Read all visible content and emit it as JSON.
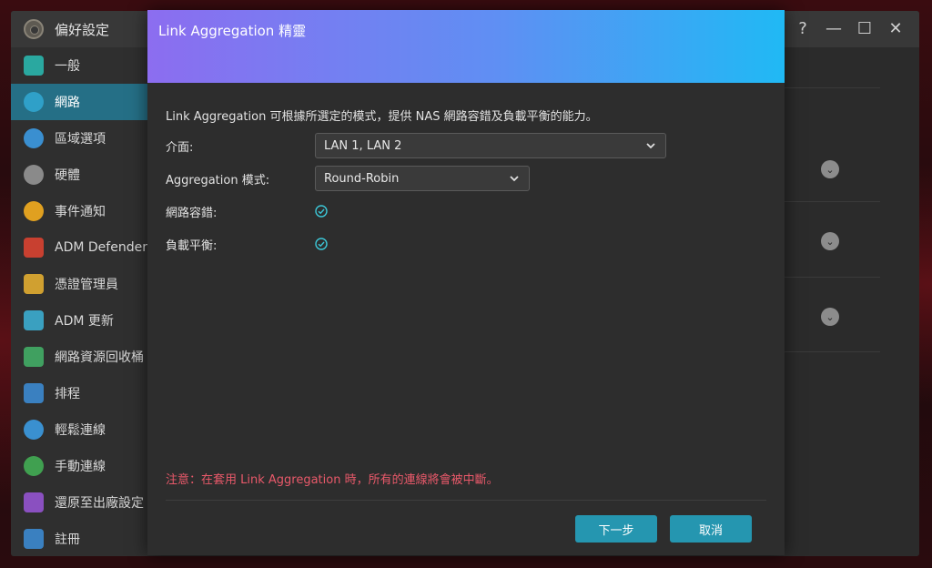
{
  "window": {
    "title": "偏好設定",
    "controls": {
      "help": "?",
      "minimize": "—",
      "maximize": "☐",
      "close": "✕"
    }
  },
  "sidebar": {
    "items": [
      {
        "label": "一般",
        "icon": "general-icon",
        "color": "#2aa8a0"
      },
      {
        "label": "網路",
        "icon": "network-globe-icon",
        "color": "#2fa0c8",
        "active": true
      },
      {
        "label": "區域選項",
        "icon": "region-icon",
        "color": "#3a8fd0"
      },
      {
        "label": "硬體",
        "icon": "hardware-icon",
        "color": "#8a8a8a"
      },
      {
        "label": "事件通知",
        "icon": "notification-icon",
        "color": "#e0a020"
      },
      {
        "label": "ADM Defender",
        "icon": "defender-icon",
        "color": "#c84030"
      },
      {
        "label": "憑證管理員",
        "icon": "certificate-icon",
        "color": "#d0a030"
      },
      {
        "label": "ADM 更新",
        "icon": "update-icon",
        "color": "#3aa0c0"
      },
      {
        "label": "網路資源回收桶",
        "icon": "recycle-bin-icon",
        "color": "#40a060"
      },
      {
        "label": "排程",
        "icon": "schedule-icon",
        "color": "#3a80c0"
      },
      {
        "label": "輕鬆連線",
        "icon": "ezconnect-icon",
        "color": "#3a90d0"
      },
      {
        "label": "手動連線",
        "icon": "manual-connect-icon",
        "color": "#40a050"
      },
      {
        "label": "還原至出廠設定",
        "icon": "reset-icon",
        "color": "#8a50c0"
      },
      {
        "label": "註冊",
        "icon": "registration-icon",
        "color": "#3a80c0"
      }
    ]
  },
  "dialog": {
    "title": "Link Aggregation 精靈",
    "description": "Link Aggregation 可根據所選定的模式，提供 NAS 網路容錯及負載平衡的能力。",
    "interface_label": "介面:",
    "interface_value": "LAN 1, LAN 2",
    "mode_label": "Aggregation 模式:",
    "mode_value": "Round-Robin",
    "fault_tolerance_label": "網路容錯:",
    "load_balance_label": "負載平衡:",
    "notice": "注意：在套用 Link Aggregation 時，所有的連線將會被中斷。",
    "next_button": "下一步",
    "cancel_button": "取消"
  },
  "colors": {
    "accent": "#2596b0",
    "active_sidebar": "#256f86",
    "notice": "#e9596a",
    "check": "#3cc8d8"
  }
}
